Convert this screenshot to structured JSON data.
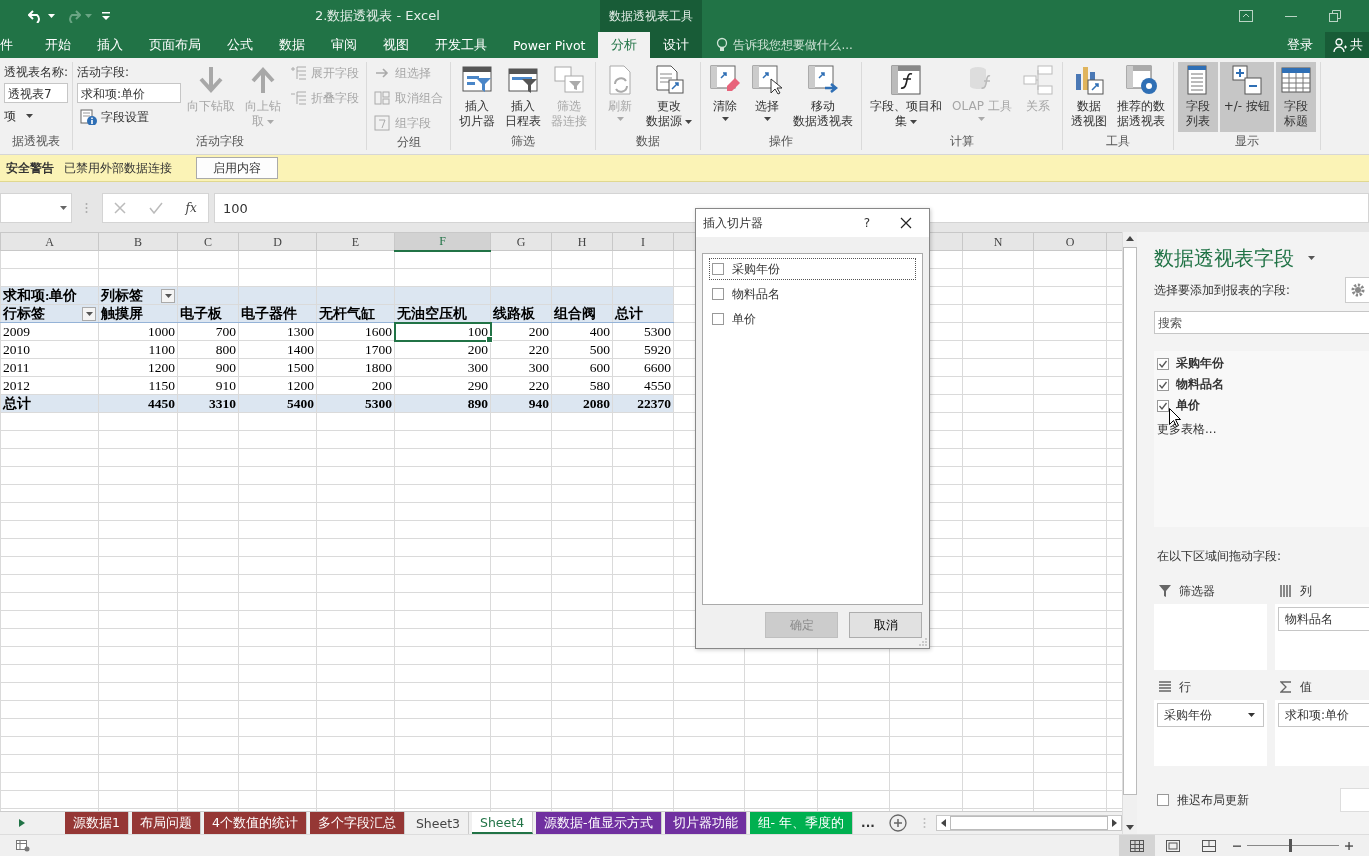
{
  "title_bar": {
    "quick_access": [
      {
        "kind": "undo",
        "disabled": false
      },
      {
        "kind": "redo",
        "disabled": true
      },
      {
        "kind": "customize",
        "disabled": false
      }
    ],
    "title": "2.数据透视表 - Excel",
    "context_title": "数据透视表工具"
  },
  "tabs": [
    {
      "label": "件",
      "selected": false,
      "contextual": false
    },
    {
      "label": "开始",
      "selected": false,
      "contextual": false
    },
    {
      "label": "插入",
      "selected": false,
      "contextual": false
    },
    {
      "label": "页面布局",
      "selected": false,
      "contextual": false
    },
    {
      "label": "公式",
      "selected": false,
      "contextual": false
    },
    {
      "label": "数据",
      "selected": false,
      "contextual": false
    },
    {
      "label": "审阅",
      "selected": false,
      "contextual": false
    },
    {
      "label": "视图",
      "selected": false,
      "contextual": false
    },
    {
      "label": "开发工具",
      "selected": false,
      "contextual": false
    },
    {
      "label": "Power Pivot",
      "selected": false,
      "contextual": false
    },
    {
      "label": "分析",
      "selected": true,
      "contextual": true
    },
    {
      "label": "设计",
      "selected": false,
      "contextual": true
    }
  ],
  "tell_me": "告诉我您想要做什么...",
  "sign_in": "登录",
  "share": "共",
  "ribbon": {
    "groups": [
      {
        "label": "据透视表",
        "columns": [
          [
            {
              "kind": "label",
              "text": "透视表名称:"
            },
            {
              "kind": "field",
              "value": "透视表7"
            },
            {
              "kind": "menu",
              "text": "项"
            }
          ]
        ]
      },
      {
        "label": "活动字段",
        "columns": [
          [
            {
              "kind": "label",
              "text": "活动字段:"
            },
            {
              "kind": "field",
              "value": "求和项:单价"
            },
            {
              "kind": "small",
              "text": "字段设置",
              "disabled": false
            }
          ],
          [
            {
              "kind": "large",
              "text": "向下钻取",
              "disabled": true
            }
          ],
          [
            {
              "kind": "large",
              "lines": [
                "向上钻",
                "取"
              ],
              "disabled": true,
              "dropdown": true
            }
          ],
          [
            {
              "kind": "small",
              "text": "展开字段",
              "disabled": true
            },
            {
              "kind": "small",
              "text": "折叠字段",
              "disabled": true
            }
          ]
        ]
      },
      {
        "label": "分组",
        "columns": [
          [
            {
              "kind": "small",
              "text": "组选择",
              "disabled": true
            },
            {
              "kind": "small",
              "text": "取消组合",
              "disabled": true
            },
            {
              "kind": "small",
              "text": "组字段",
              "disabled": true
            }
          ]
        ]
      },
      {
        "label": "筛选",
        "columns": [
          [
            {
              "kind": "large",
              "lines": [
                "插入",
                "切片器"
              ],
              "disabled": false
            }
          ],
          [
            {
              "kind": "large",
              "lines": [
                "插入",
                "日程表"
              ],
              "disabled": false
            }
          ],
          [
            {
              "kind": "large",
              "lines": [
                "筛选",
                "器连接"
              ],
              "disabled": true
            }
          ]
        ]
      },
      {
        "label": "数据",
        "columns": [
          [
            {
              "kind": "large",
              "text": "刷新",
              "disabled": true,
              "dropdown": true
            }
          ],
          [
            {
              "kind": "large",
              "lines": [
                "更改",
                "数据源"
              ],
              "disabled": false,
              "dropdown": true
            }
          ]
        ]
      },
      {
        "label": "操作",
        "columns": [
          [
            {
              "kind": "large",
              "text": "清除",
              "disabled": false,
              "dropdown": true
            }
          ],
          [
            {
              "kind": "large",
              "text": "选择",
              "disabled": false,
              "dropdown": true
            }
          ],
          [
            {
              "kind": "large",
              "lines": [
                "移动",
                "数据透视表"
              ],
              "disabled": false
            }
          ]
        ]
      },
      {
        "label": "计算",
        "columns": [
          [
            {
              "kind": "large",
              "lines": [
                "字段、项目和",
                "集"
              ],
              "disabled": false,
              "dropdown": true
            }
          ],
          [
            {
              "kind": "large",
              "text": "OLAP 工具",
              "disabled": true,
              "dropdown": true
            }
          ],
          [
            {
              "kind": "large",
              "text": "关系",
              "disabled": true
            }
          ]
        ]
      },
      {
        "label": "工具",
        "columns": [
          [
            {
              "kind": "large",
              "lines": [
                "数据",
                "透视图"
              ],
              "disabled": false
            }
          ],
          [
            {
              "kind": "large",
              "lines": [
                "推荐的数",
                "据透视表"
              ],
              "disabled": false
            }
          ]
        ]
      },
      {
        "label": "显示",
        "columns": [
          [
            {
              "kind": "large",
              "lines": [
                "字段",
                "列表"
              ],
              "disabled": false,
              "on": true
            }
          ],
          [
            {
              "kind": "large",
              "text": "+/- 按钮",
              "disabled": false,
              "on": true
            }
          ],
          [
            {
              "kind": "large",
              "lines": [
                "字段",
                "标题"
              ],
              "disabled": false,
              "on": true
            }
          ]
        ]
      }
    ]
  },
  "security_bar": {
    "title": "安全警告",
    "message": "已禁用外部数据连接",
    "button": "启用内容"
  },
  "formula_bar": {
    "insert_function": "fx",
    "formula": "100"
  },
  "sheet": {
    "columns": [
      {
        "letter": "A",
        "selected": false
      },
      {
        "letter": "B",
        "selected": false
      },
      {
        "letter": "C",
        "selected": false
      },
      {
        "letter": "D",
        "selected": false
      },
      {
        "letter": "E",
        "selected": false
      },
      {
        "letter": "F",
        "selected": true
      },
      {
        "letter": "G",
        "selected": false
      },
      {
        "letter": "H",
        "selected": false
      },
      {
        "letter": "I",
        "selected": false
      },
      {
        "selected": false
      },
      {
        "selected": false
      },
      {
        "letter": "N",
        "selected": false
      },
      {
        "letter": "O",
        "selected": false
      },
      {
        "selected": false
      }
    ],
    "pivot": {
      "value_label": "求和项:单价",
      "column_label": "列标签",
      "row_label": "行标签",
      "columns": [
        "触摸屏",
        "电子板",
        "电子器件",
        "无杆气缸",
        "无油空压机",
        "线路板",
        "组合阀",
        "总计"
      ],
      "rows": [
        {
          "label": "2009",
          "cells": [
            {
              "value": "1000",
              "selected": false
            },
            {
              "value": "700",
              "selected": false
            },
            {
              "value": "1300",
              "selected": false
            },
            {
              "value": "1600",
              "selected": false
            },
            {
              "value": "100",
              "selected": true
            },
            {
              "value": "200",
              "selected": false
            },
            {
              "value": "400",
              "selected": false
            },
            {
              "value": "5300",
              "selected": false
            }
          ]
        },
        {
          "label": "2010",
          "cells": [
            {
              "value": "1100",
              "selected": false
            },
            {
              "value": "800",
              "selected": false
            },
            {
              "value": "1400",
              "selected": false
            },
            {
              "value": "1700",
              "selected": false
            },
            {
              "value": "200",
              "selected": false
            },
            {
              "value": "220",
              "selected": false
            },
            {
              "value": "500",
              "selected": false
            },
            {
              "value": "5920",
              "selected": false
            }
          ]
        },
        {
          "label": "2011",
          "cells": [
            {
              "value": "1200",
              "selected": false
            },
            {
              "value": "900",
              "selected": false
            },
            {
              "value": "1500",
              "selected": false
            },
            {
              "value": "1800",
              "selected": false
            },
            {
              "value": "300",
              "selected": false
            },
            {
              "value": "300",
              "selected": false
            },
            {
              "value": "600",
              "selected": false
            },
            {
              "value": "6600",
              "selected": false
            }
          ]
        },
        {
          "label": "2012",
          "cells": [
            {
              "value": "1150",
              "selected": false
            },
            {
              "value": "910",
              "selected": false
            },
            {
              "value": "1200",
              "selected": false
            },
            {
              "value": "200",
              "selected": false
            },
            {
              "value": "290",
              "selected": false
            },
            {
              "value": "220",
              "selected": false
            },
            {
              "value": "580",
              "selected": false
            },
            {
              "value": "4550",
              "selected": false
            }
          ]
        }
      ],
      "total": {
        "label": "总计",
        "values": [
          "4450",
          "3310",
          "5400",
          "5300",
          "890",
          "940",
          "2080",
          "22370"
        ]
      }
    }
  },
  "dialog": {
    "title": "插入切片器",
    "help": "?",
    "fields": [
      {
        "label": "采购年份",
        "checked": false,
        "focused": true
      },
      {
        "label": "物料品名",
        "checked": false,
        "focused": false
      },
      {
        "label": "单价",
        "checked": false,
        "focused": false
      }
    ],
    "buttons": [
      {
        "label": "确定",
        "disabled": true
      },
      {
        "label": "取消",
        "disabled": false
      }
    ]
  },
  "field_pane": {
    "title": "数据透视表字段",
    "prompt": "选择要添加到报表的字段:",
    "search_placeholder": "搜索",
    "fields": [
      {
        "label": "采购年份",
        "checked": true
      },
      {
        "label": "物料品名",
        "checked": true
      },
      {
        "label": "单价",
        "checked": true
      }
    ],
    "more_tables": "更多表格...",
    "areas_prompt": "在以下区域间拖动字段:",
    "areas": [
      {
        "kind": "filters",
        "label": "筛选器"
      },
      {
        "kind": "columns",
        "label": "列",
        "items": [
          {
            "label": "物料品名"
          }
        ]
      },
      {
        "kind": "rows",
        "label": "行",
        "items": [
          {
            "label": "采购年份",
            "dropdown": true
          }
        ]
      },
      {
        "kind": "values",
        "label": "值",
        "items": [
          {
            "label": "求和项:单价"
          }
        ]
      }
    ],
    "defer": {
      "label": "推迟布局更新",
      "checked": false
    }
  },
  "sheet_tabs": {
    "overflow": "...",
    "tabs": [
      {
        "label": "源数据1",
        "color": "#953735",
        "selected": false
      },
      {
        "label": "布局问题",
        "color": "#953735",
        "selected": false
      },
      {
        "label": "4个数值的统计",
        "color": "#953735",
        "selected": false
      },
      {
        "label": "多个字段汇总",
        "color": "#953735",
        "selected": false
      },
      {
        "label": "Sheet3",
        "selected": false
      },
      {
        "label": "Sheet4",
        "selected": true
      },
      {
        "label": "源数据-值显示方式",
        "color": "#7030a0",
        "selected": false
      },
      {
        "label": "切片器功能",
        "color": "#7030a0",
        "selected": false
      },
      {
        "label": "组- 年、季度的",
        "color": "#00b050",
        "selected": false
      }
    ]
  },
  "status_bar": {
    "views": [
      {
        "kind": "normal",
        "selected": true
      },
      {
        "kind": "page_layout",
        "selected": false
      },
      {
        "kind": "page_break",
        "selected": false
      }
    ],
    "zoom": {
      "level": 0.47
    }
  }
}
